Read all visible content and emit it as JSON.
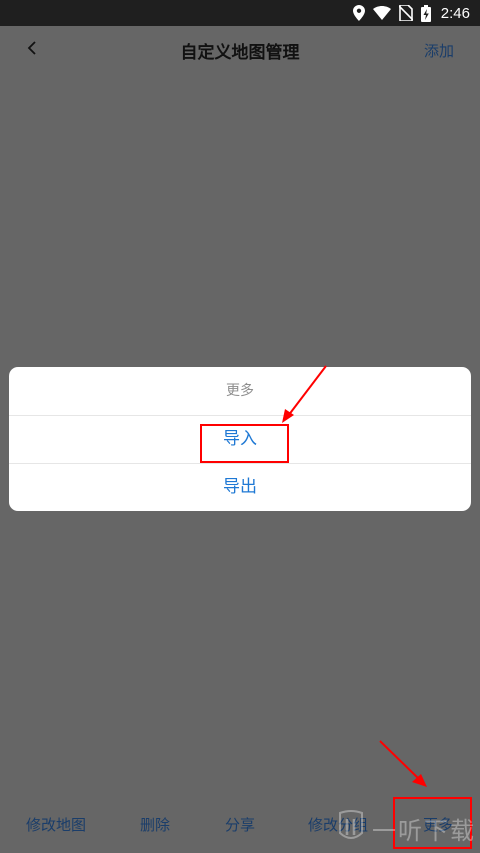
{
  "status_bar": {
    "time": "2:46",
    "icons": [
      "location-icon",
      "wifi-icon",
      "no-sim-icon",
      "battery-charging-icon"
    ]
  },
  "nav": {
    "back_icon": "chevron-left-icon",
    "title": "自定义地图管理",
    "add_label": "添加"
  },
  "dialog": {
    "title": "更多",
    "options": [
      {
        "label": "导入"
      },
      {
        "label": "导出"
      }
    ]
  },
  "bottom_bar": {
    "items": [
      {
        "label": "修改地图"
      },
      {
        "label": "删除"
      },
      {
        "label": "分享"
      },
      {
        "label": "修改分组"
      },
      {
        "label": "更多"
      }
    ]
  },
  "watermark": {
    "text": "一听下载"
  },
  "colors": {
    "overlay": "#666666",
    "accent": "#1e78d4",
    "annotation": "#ff0000",
    "status_bar": "#1f1f1f"
  }
}
